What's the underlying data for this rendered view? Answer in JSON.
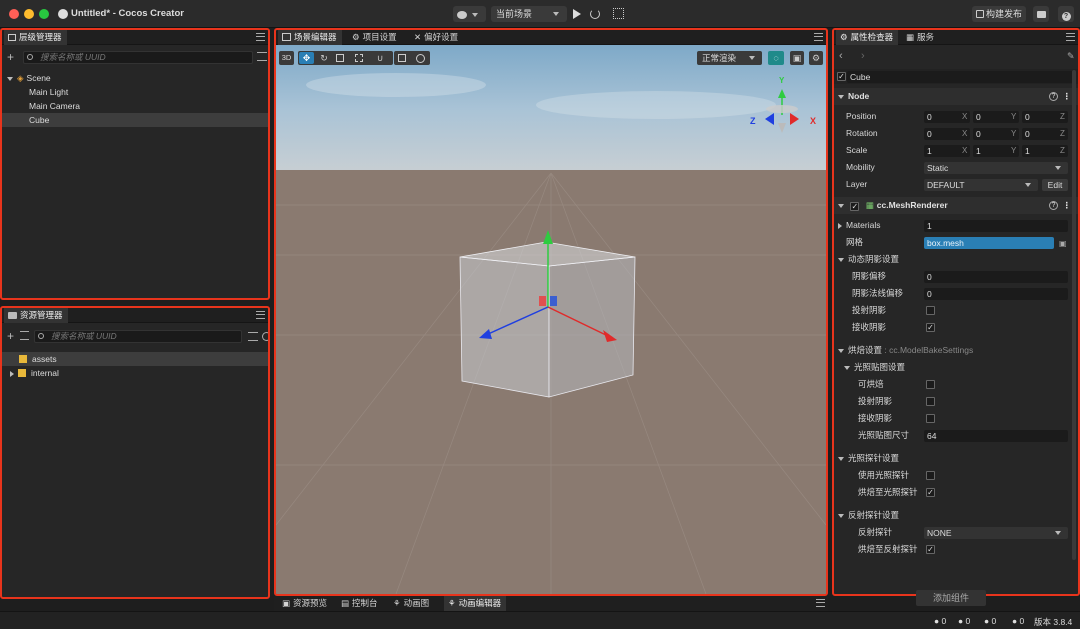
{
  "window": {
    "title": "Untitled* - Cocos Creator"
  },
  "toolbar": {
    "scene_select": "当前场景",
    "build_label": "构建发布"
  },
  "hierarchy": {
    "tab": "层级管理器",
    "search_placeholder": "搜索名称或 UUID",
    "root": "Scene",
    "nodes": [
      "Main Light",
      "Main Camera",
      "Cube"
    ],
    "selected": "Cube"
  },
  "assets": {
    "tab": "资源管理器",
    "search_placeholder": "搜索名称或 UUID",
    "items": [
      "assets",
      "internal"
    ]
  },
  "scene": {
    "tabs": [
      "场景编辑器",
      "项目设置",
      "偏好设置"
    ],
    "mode_3d": "3D",
    "render_mode": "正常渲染",
    "gizmo_labels": {
      "y": "Y",
      "x": "X",
      "z": "Z"
    }
  },
  "bottom_tabs": [
    "资源预览",
    "控制台",
    "动画图",
    "动画编辑器"
  ],
  "inspector": {
    "tabs": [
      "属性检查器",
      "服务"
    ],
    "node_name": "Cube",
    "node_section": "Node",
    "position": {
      "label": "Position",
      "x": "0",
      "y": "0",
      "z": "0"
    },
    "rotation": {
      "label": "Rotation",
      "x": "0",
      "y": "0",
      "z": "0"
    },
    "scale": {
      "label": "Scale",
      "x": "1",
      "y": "1",
      "z": "1"
    },
    "axis": {
      "x": "X",
      "y": "Y",
      "z": "Z"
    },
    "mobility": {
      "label": "Mobility",
      "value": "Static"
    },
    "layer": {
      "label": "Layer",
      "value": "DEFAULT",
      "edit": "Edit"
    },
    "component": "cc.MeshRenderer",
    "materials": {
      "label": "Materials",
      "value": "1"
    },
    "mesh": {
      "label": "网格",
      "value": "box.mesh"
    },
    "dynamic_shadow": {
      "label": "动态阴影设置",
      "offset_label": "阴影偏移",
      "offset": "0",
      "normal_offset_label": "阴影法线偏移",
      "normal_offset": "0",
      "cast_label": "投射阴影",
      "receive_label": "接收阴影"
    },
    "bake": {
      "label": "烘焙设置",
      "type": ": cc.ModelBakeSettings",
      "lightmap_label": "光照贴图设置",
      "bakeable": "可烘焙",
      "cast": "投射阴影",
      "receive": "接收阴影",
      "lightmap_size_label": "光照贴图尺寸",
      "lightmap_size": "64",
      "probe_label": "光照探针设置",
      "use_probe": "使用光照探针",
      "bake_to_probe": "烘焙至光照探针",
      "reflection_label": "反射探针设置",
      "reflection_probe": "反射探针",
      "reflection_value": "NONE",
      "bake_to_reflection": "烘焙至反射探针"
    },
    "add_component": "添加组件"
  },
  "status": {
    "c1": "0",
    "c2": "0",
    "c3": "0",
    "c4": "0",
    "version": "版本 3.8.4"
  },
  "colors": {
    "accent_red": "#e8341c",
    "axis_x": "#e02a2a",
    "axis_y": "#2ecc40",
    "axis_z": "#1f3fe0",
    "mesh_field": "#2a7fb5"
  }
}
